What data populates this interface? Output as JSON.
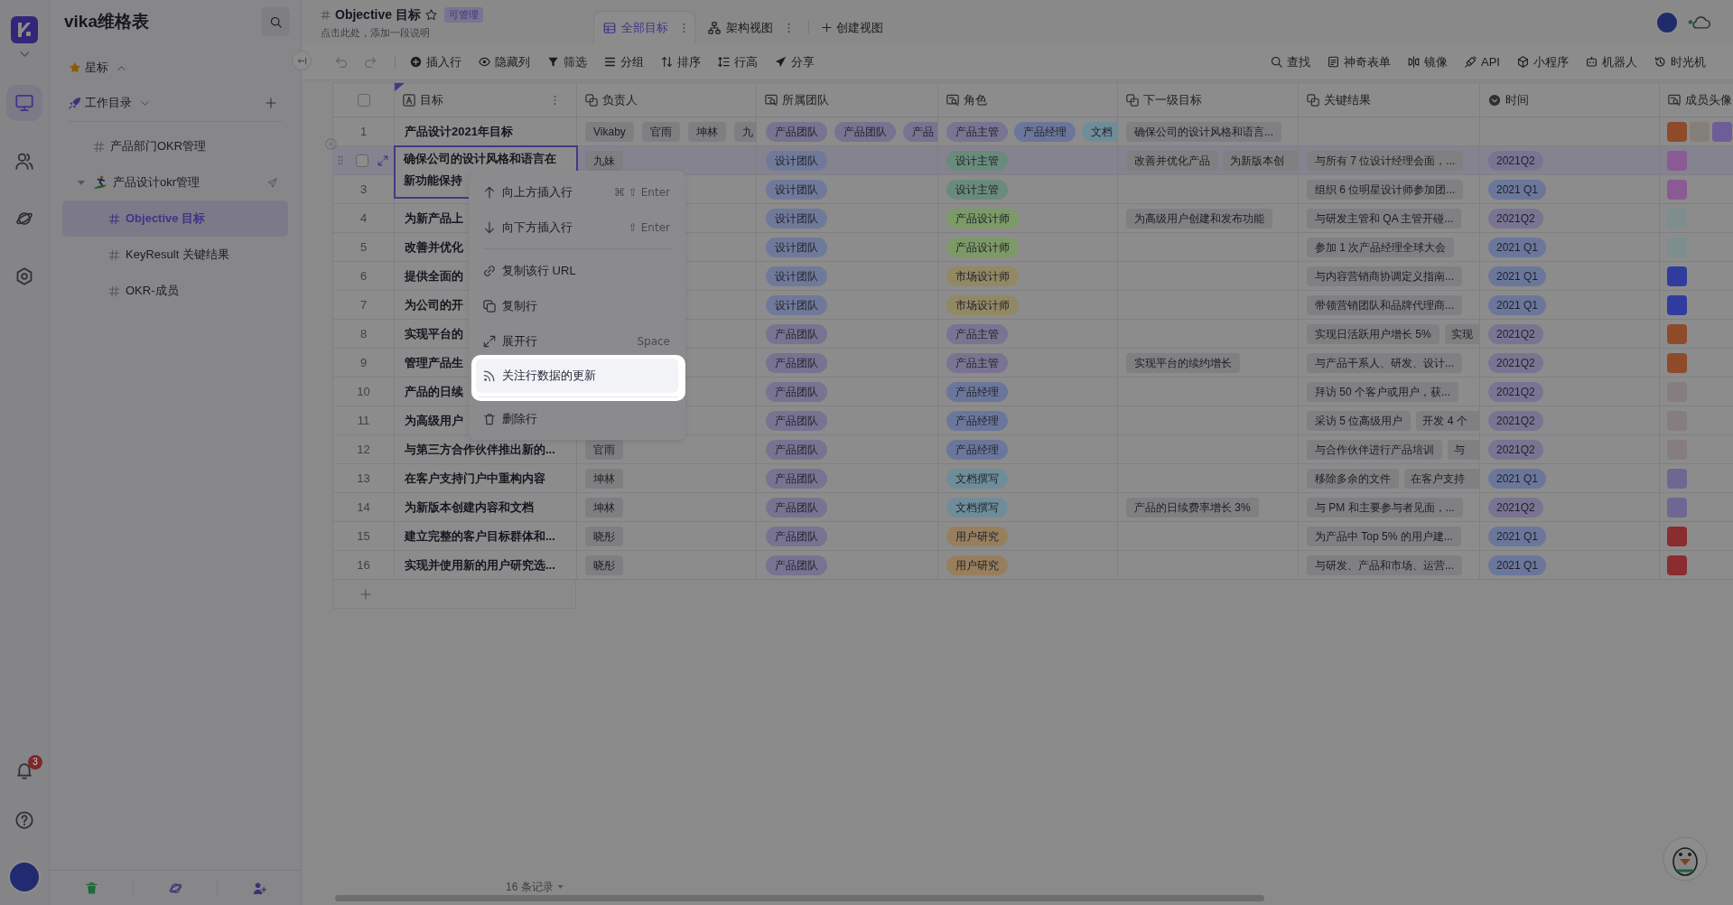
{
  "rail": {
    "items": [
      {
        "selected": true
      },
      {
        "selected": false
      },
      {
        "selected": false
      },
      {
        "selected": false
      }
    ],
    "notification_count": "3"
  },
  "sidebar": {
    "title": "vika维格表",
    "starred": {
      "label": "星标",
      "expanded": false
    },
    "workspace": {
      "label": "工作目录",
      "expanded": true
    },
    "tree": [
      {
        "label": "产品部门OKR管理",
        "kind": "datasheet",
        "selected": false
      },
      {
        "label": "产品设计okr管理",
        "kind": "folder",
        "selected": false,
        "expanded": true,
        "children": [
          {
            "label": "Objective 目标",
            "kind": "datasheet",
            "selected": true
          },
          {
            "label": "KeyResult 关键结果",
            "kind": "datasheet",
            "selected": false
          },
          {
            "label": "OKR-成员",
            "kind": "datasheet",
            "selected": false
          }
        ]
      }
    ]
  },
  "header": {
    "title": "Objective 目标",
    "starred": false,
    "permission": "可管理",
    "description": "点击此处，添加一段说明",
    "views": [
      {
        "label": "全部目标",
        "kind": "grid",
        "selected": true
      },
      {
        "label": "架构视图",
        "kind": "architecture",
        "selected": false
      }
    ],
    "create_view": "创建视图"
  },
  "toolbar": {
    "left": [
      "插入行",
      "隐藏列",
      "筛选",
      "分组",
      "排序",
      "行高",
      "分享"
    ],
    "right": [
      "查找",
      "神奇表单",
      "镜像",
      "API",
      "小程序",
      "机器人",
      "时光机"
    ]
  },
  "table": {
    "select_all_checked": false,
    "columns": [
      {
        "label": "目标",
        "kind": "text"
      },
      {
        "label": "负责人",
        "kind": "link"
      },
      {
        "label": "所属团队",
        "kind": "lookup"
      },
      {
        "label": "角色",
        "kind": "lookup"
      },
      {
        "label": "下一级目标",
        "kind": "link"
      },
      {
        "label": "关键结果",
        "kind": "link"
      },
      {
        "label": "时间",
        "kind": "select"
      },
      {
        "label": "成员头像",
        "kind": "lookup"
      }
    ],
    "rows": [
      {
        "number": "1",
        "active": false,
        "checked": false,
        "goal": "产品设计2021年目标",
        "owners": [
          {
            "text": "Vikaby"
          },
          {
            "text": "官雨"
          },
          {
            "text": "坤林"
          },
          {
            "text": "九",
            "cut": true
          }
        ],
        "teams": [
          {
            "text": "产品团队",
            "color": "#787391"
          },
          {
            "text": "产品团队",
            "color": "#787391"
          },
          {
            "text": "产品",
            "color": "#787391",
            "cut": true
          }
        ],
        "roles": [
          {
            "text": "产品主管",
            "color": "#7a7492"
          },
          {
            "text": "产品经理",
            "color": "#6b779a"
          },
          {
            "text": "文档",
            "color": "#6f8d99",
            "cut": true
          }
        ],
        "next_goals": [
          {
            "text": "确保公司的设计风格和语言..."
          }
        ],
        "avatars": [
          {
            "color": "#8f4a2a"
          },
          {
            "color": "#857f79"
          },
          {
            "color": "#6e5d98"
          }
        ]
      },
      {
        "active": true,
        "checked": false,
        "goal_lines": [
          "确保公司的设计风格和语言在",
          "新功能保持"
        ],
        "owners": [
          {
            "text": "九妹"
          }
        ],
        "teams": [
          {
            "text": "设计团队",
            "color": "#6f7a9a"
          }
        ],
        "roles": [
          {
            "text": "设计主管",
            "color": "#6a8b7b"
          }
        ],
        "next_goals": [
          {
            "text": "改善并优化产品"
          },
          {
            "text": "为新版本创",
            "cut": true
          }
        ],
        "key_results": [
          {
            "text": "与所有 7 位设计经理会面，..."
          }
        ],
        "quarter": {
          "text": "2021Q2",
          "color": "#7a7492"
        },
        "avatars": [
          {
            "color": "#8a5a94"
          }
        ]
      },
      {
        "number": "3",
        "active": false,
        "checked": false,
        "teams": [
          {
            "text": "设计团队",
            "color": "#6f7a9a"
          }
        ],
        "roles": [
          {
            "text": "设计主管",
            "color": "#6a8b7b"
          }
        ],
        "key_results": [
          {
            "text": "组织 6 位明星设计师参加团..."
          }
        ],
        "quarter": {
          "text": "2021 Q1",
          "color": "#6b779a"
        },
        "avatars": [
          {
            "color": "#8a5a94"
          }
        ]
      },
      {
        "number": "4",
        "active": false,
        "checked": false,
        "goal": "为新产品上",
        "teams": [
          {
            "text": "设计团队",
            "color": "#6f7a9a"
          }
        ],
        "roles": [
          {
            "text": "产品设计师",
            "color": "#7c9a66"
          }
        ],
        "next_goals": [
          {
            "text": "为高级用户创建和发布功能"
          }
        ],
        "key_results": [
          {
            "text": "与研发主管和 QA 主管开碰..."
          }
        ],
        "quarter": {
          "text": "2021Q2",
          "color": "#7a7492"
        },
        "avatars": [
          {
            "color": "#7d8e8c"
          }
        ]
      },
      {
        "number": "5",
        "active": false,
        "checked": false,
        "goal": "改善并优化",
        "teams": [
          {
            "text": "设计团队",
            "color": "#6f7a9a"
          }
        ],
        "roles": [
          {
            "text": "产品设计师",
            "color": "#7c9a66"
          }
        ],
        "key_results": [
          {
            "text": "参加 1 次产品经理全球大会"
          }
        ],
        "quarter": {
          "text": "2021 Q1",
          "color": "#6b779a"
        },
        "avatars": [
          {
            "color": "#7d8e8c"
          }
        ]
      },
      {
        "number": "6",
        "active": false,
        "checked": false,
        "goal": "提供全面的",
        "teams": [
          {
            "text": "设计团队",
            "color": "#6f7a9a"
          }
        ],
        "roles": [
          {
            "text": "市场设计师",
            "color": "#928864"
          }
        ],
        "key_results": [
          {
            "text": "与内容营销商协调定义指南..."
          }
        ],
        "quarter": {
          "text": "2021 Q1",
          "color": "#6b779a"
        },
        "avatars": [
          {
            "color": "#2f3c9e"
          }
        ]
      },
      {
        "number": "7",
        "active": false,
        "checked": false,
        "goal": "为公司的开",
        "teams": [
          {
            "text": "设计团队",
            "color": "#6f7a9a"
          }
        ],
        "roles": [
          {
            "text": "市场设计师",
            "color": "#928864"
          }
        ],
        "key_results": [
          {
            "text": "带领营销团队和品牌代理商..."
          }
        ],
        "quarter": {
          "text": "2021 Q1",
          "color": "#6b779a"
        },
        "avatars": [
          {
            "color": "#2f3c9e"
          }
        ]
      },
      {
        "number": "8",
        "active": false,
        "checked": false,
        "goal": "实现平台的",
        "teams": [
          {
            "text": "产品团队",
            "color": "#787391"
          }
        ],
        "roles": [
          {
            "text": "产品主管",
            "color": "#7a7492"
          }
        ],
        "key_results": [
          {
            "text": "实现日活跃用户增长 5%"
          },
          {
            "text": "实现",
            "cut": true
          }
        ],
        "quarter": {
          "text": "2021Q2",
          "color": "#7a7492"
        },
        "avatars": [
          {
            "color": "#8f4a2a"
          }
        ]
      },
      {
        "number": "9",
        "active": false,
        "checked": false,
        "goal": "管理产品生",
        "teams": [
          {
            "text": "产品团队",
            "color": "#787391"
          }
        ],
        "roles": [
          {
            "text": "产品主管",
            "color": "#7a7492"
          }
        ],
        "next_goals": [
          {
            "text": "实现平台的续约增长"
          }
        ],
        "key_results": [
          {
            "text": "与产品干系人、研发、设计..."
          }
        ],
        "quarter": {
          "text": "2021Q2",
          "color": "#7a7492"
        },
        "avatars": [
          {
            "color": "#8f4a2a"
          }
        ]
      },
      {
        "number": "10",
        "active": false,
        "checked": false,
        "goal": "产品的日续",
        "teams": [
          {
            "text": "产品团队",
            "color": "#787391"
          }
        ],
        "roles": [
          {
            "text": "产品经理",
            "color": "#6b779a"
          }
        ],
        "key_results": [
          {
            "text": "拜访 50 个客户或用户，获..."
          }
        ],
        "quarter": {
          "text": "2021Q2",
          "color": "#7a7492"
        },
        "avatars": [
          {
            "color": "#867d80"
          }
        ]
      },
      {
        "number": "11",
        "active": false,
        "checked": false,
        "goal": "为高级用户",
        "teams": [
          {
            "text": "产品团队",
            "color": "#787391"
          }
        ],
        "roles": [
          {
            "text": "产品经理",
            "color": "#6b779a"
          }
        ],
        "key_results": [
          {
            "text": "采访 5 位高级用户"
          },
          {
            "text": "开发 4 个",
            "cut": true
          }
        ],
        "quarter": {
          "text": "2021Q2",
          "color": "#7a7492"
        },
        "avatars": [
          {
            "color": "#867d80"
          }
        ]
      },
      {
        "number": "12",
        "active": false,
        "checked": false,
        "goal": "与第三方合作伙伴推出新的...",
        "owners": [
          {
            "text": "官雨"
          }
        ],
        "teams": [
          {
            "text": "产品团队",
            "color": "#787391"
          }
        ],
        "roles": [
          {
            "text": "产品经理",
            "color": "#6b779a"
          }
        ],
        "key_results": [
          {
            "text": "与合作伙伴进行产品培训"
          },
          {
            "text": "与",
            "cut": true
          }
        ],
        "quarter": {
          "text": "2021Q2",
          "color": "#7a7492"
        },
        "avatars": [
          {
            "color": "#867d80"
          }
        ]
      },
      {
        "number": "13",
        "active": false,
        "checked": false,
        "goal": "在客户支持门户中重构内容",
        "owners": [
          {
            "text": "坤林"
          }
        ],
        "teams": [
          {
            "text": "产品团队",
            "color": "#787391"
          }
        ],
        "roles": [
          {
            "text": "文档撰写",
            "color": "#6f8d99"
          }
        ],
        "key_results": [
          {
            "text": "移除多余的文件"
          },
          {
            "text": "在客户支持",
            "cut": true
          }
        ],
        "quarter": {
          "text": "2021 Q1",
          "color": "#6b779a"
        },
        "avatars": [
          {
            "color": "#6f6791"
          }
        ]
      },
      {
        "number": "14",
        "active": false,
        "checked": false,
        "goal": "为新版本创建内容和文档",
        "owners": [
          {
            "text": "坤林"
          }
        ],
        "teams": [
          {
            "text": "产品团队",
            "color": "#787391"
          }
        ],
        "roles": [
          {
            "text": "文档撰写",
            "color": "#6f8d99"
          }
        ],
        "next_goals": [
          {
            "text": "产品的日续费率增长 3%"
          }
        ],
        "key_results": [
          {
            "text": "与 PM 和主要参与者见面，..."
          }
        ],
        "quarter": {
          "text": "2021Q2",
          "color": "#7a7492"
        },
        "avatars": [
          {
            "color": "#6f6791"
          }
        ]
      },
      {
        "number": "15",
        "active": false,
        "checked": false,
        "goal": "建立完整的客户目标群体和...",
        "owners": [
          {
            "text": "晓彤"
          }
        ],
        "teams": [
          {
            "text": "产品团队",
            "color": "#787391"
          }
        ],
        "roles": [
          {
            "text": "用户研究",
            "color": "#977f5e"
          }
        ],
        "key_results": [
          {
            "text": "为产品中 Top 5% 的用户建..."
          }
        ],
        "quarter": {
          "text": "2021 Q1",
          "color": "#6b779a"
        },
        "avatars": [
          {
            "color": "#8a2c30"
          }
        ]
      },
      {
        "number": "16",
        "active": false,
        "checked": false,
        "goal": "实现并使用新的用户研究选...",
        "owners": [
          {
            "text": "晓彤"
          }
        ],
        "teams": [
          {
            "text": "产品团队",
            "color": "#787391"
          }
        ],
        "roles": [
          {
            "text": "用户研究",
            "color": "#977f5e"
          }
        ],
        "key_results": [
          {
            "text": "与研发、产品和市场、运营..."
          }
        ],
        "quarter": {
          "text": "2021 Q1",
          "color": "#6b779a"
        },
        "avatars": [
          {
            "color": "#8a2c30"
          }
        ]
      }
    ]
  },
  "footer": {
    "record_count": "16 条记录"
  },
  "context_menu": {
    "groups": [
      {
        "items": [
          {
            "label": "向上方插入行",
            "shortcut": "⌘ ⇧ Enter",
            "highlighted": false
          },
          {
            "label": "向下方插入行",
            "shortcut": "⇧ Enter",
            "highlighted": false
          }
        ]
      },
      {
        "items": [
          {
            "label": "复制该行 URL",
            "highlighted": false
          },
          {
            "label": "复制行",
            "highlighted": false
          },
          {
            "label": "展开行",
            "shortcut": "Space",
            "highlighted": false
          },
          {
            "label": "关注行数据的更新",
            "highlighted": true
          }
        ]
      },
      {
        "items": [
          {
            "label": "删除行",
            "highlighted": false
          }
        ]
      }
    ]
  }
}
